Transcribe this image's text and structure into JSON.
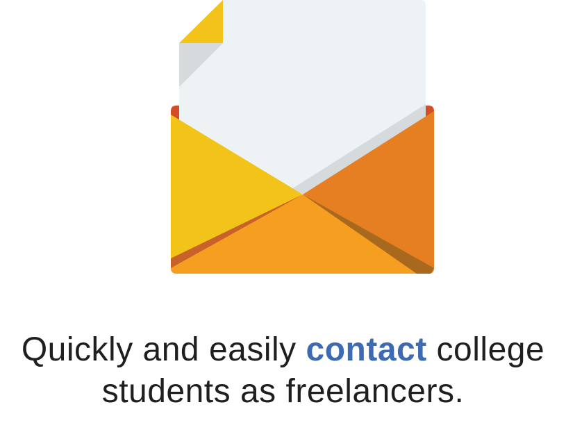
{
  "illustration": {
    "icon": "open-envelope-with-letter-icon",
    "colors": {
      "letter": "#EDF2F5",
      "letter_shadow": "#D5DADC",
      "letter_fold": "#F2C318",
      "left_flap": "#F2C318",
      "right_flap": "#E67E22",
      "bottom_flap": "#F59E1F",
      "inner": "#D24E27"
    }
  },
  "tagline": {
    "prefix": "Quickly and easily ",
    "emphasis": "contact",
    "suffix_line1": " college",
    "line2": "students as freelancers.",
    "emphasis_color": "#3D6BB3"
  }
}
